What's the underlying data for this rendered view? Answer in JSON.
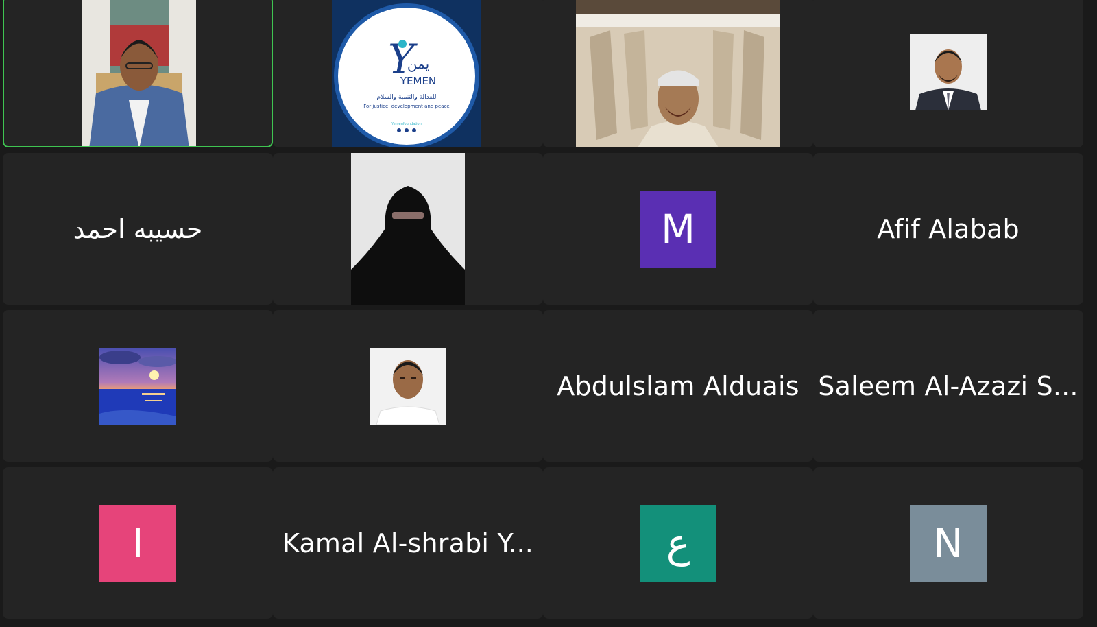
{
  "participants": [
    {
      "name": "",
      "type": "video",
      "active": true
    },
    {
      "name": "",
      "type": "logo",
      "logo_text": {
        "arabic_name": "يمن",
        "english_name": "YEMEN",
        "arabic_tagline": "للعدالة والتنمية والسلام",
        "english_tagline": "For justice, development and peace",
        "handle": "Yemenfoundation"
      }
    },
    {
      "name": "",
      "type": "video"
    },
    {
      "name": "",
      "type": "photo"
    },
    {
      "name": "حسيبه احمد",
      "type": "name"
    },
    {
      "name": "",
      "type": "photo"
    },
    {
      "name": "",
      "type": "initial",
      "initial": "M",
      "color": "#5a2fb3"
    },
    {
      "name": "Afif Alabab",
      "type": "name"
    },
    {
      "name": "",
      "type": "photo"
    },
    {
      "name": "",
      "type": "photo"
    },
    {
      "name": "Abdulslam Alduais",
      "type": "name"
    },
    {
      "name": "Saleem Al-Azazi S...",
      "type": "name"
    },
    {
      "name": "",
      "type": "initial",
      "initial": "I",
      "color": "#e6447a"
    },
    {
      "name": "Kamal Al-shrabi Y...",
      "type": "name"
    },
    {
      "name": "",
      "type": "initial",
      "initial": "ع",
      "color": "#13907a"
    },
    {
      "name": "",
      "type": "initial",
      "initial": "N",
      "color": "#7a8d9a"
    }
  ],
  "colors": {
    "background": "#1a1a1a",
    "tile": "#242424",
    "active_speaker_border": "#3fc451"
  }
}
